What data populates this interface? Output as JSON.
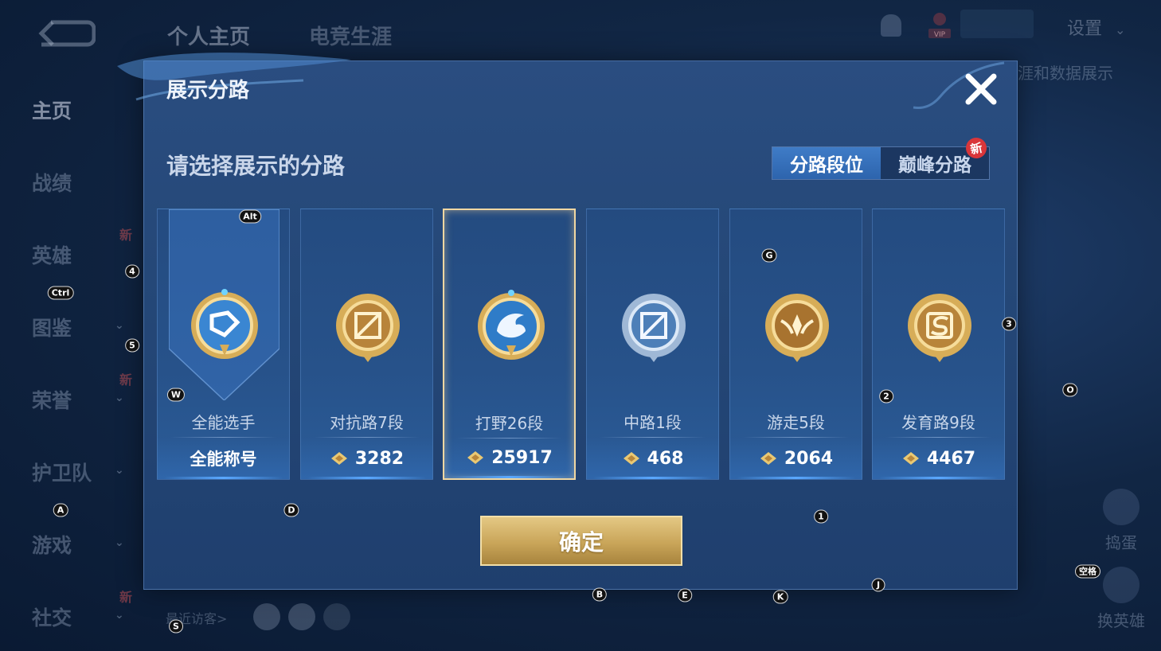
{
  "background": {
    "top_tabs": [
      "个人主页",
      "电竞生涯"
    ],
    "nav_items": [
      {
        "label": "主页",
        "has_chevron": false,
        "new": false
      },
      {
        "label": "战绩",
        "has_chevron": false,
        "new": false
      },
      {
        "label": "英雄",
        "has_chevron": false,
        "new": true
      },
      {
        "label": "图鉴",
        "has_chevron": true,
        "new": false
      },
      {
        "label": "荣誉",
        "has_chevron": true,
        "new": true
      },
      {
        "label": "护卫队",
        "has_chevron": true,
        "new": false
      },
      {
        "label": "游戏",
        "has_chevron": true,
        "new": false
      },
      {
        "label": "社交",
        "has_chevron": true,
        "new": true
      }
    ],
    "new_label": "新",
    "settings_label": "设置",
    "side_text": "涯和数据展示",
    "vip_label": "VIP",
    "visitors_label": "最近访客>",
    "right_buttons": [
      "捣蛋",
      "换英雄"
    ]
  },
  "modal": {
    "title": "展示分路",
    "subtitle": "请选择展示的分路",
    "toggle": {
      "options": [
        "分路段位",
        "巅峰分路"
      ],
      "active_index": 0,
      "badge": "新"
    },
    "cards": [
      {
        "name": "全能选手",
        "value": "全能称号",
        "kind": "title",
        "emblem": "allround-emblem",
        "selected": false
      },
      {
        "name": "对抗路7段",
        "value": "3282",
        "kind": "points",
        "emblem": "clash-lane-emblem",
        "selected": false
      },
      {
        "name": "打野26段",
        "value": "25917",
        "kind": "points",
        "emblem": "jungle-dragon-emblem",
        "selected": true
      },
      {
        "name": "中路1段",
        "value": "468",
        "kind": "points",
        "emblem": "mid-lane-emblem",
        "selected": false
      },
      {
        "name": "游走5段",
        "value": "2064",
        "kind": "points",
        "emblem": "roam-emblem",
        "selected": false
      },
      {
        "name": "发育路9段",
        "value": "4467",
        "kind": "points",
        "emblem": "farm-lane-emblem",
        "selected": false
      }
    ],
    "confirm_label": "确定"
  },
  "key_hints": [
    "Alt",
    "Ctrl",
    "4",
    "5",
    "W",
    "A",
    "D",
    "S",
    "G",
    "3",
    "2",
    "O",
    "1",
    "B",
    "E",
    "K",
    "J",
    "空格"
  ],
  "colors": {
    "accent_gold": "#e4c884",
    "selected_border": "#f0d7a2",
    "panel_blue": "#254878",
    "new_badge": "#d9363a"
  }
}
